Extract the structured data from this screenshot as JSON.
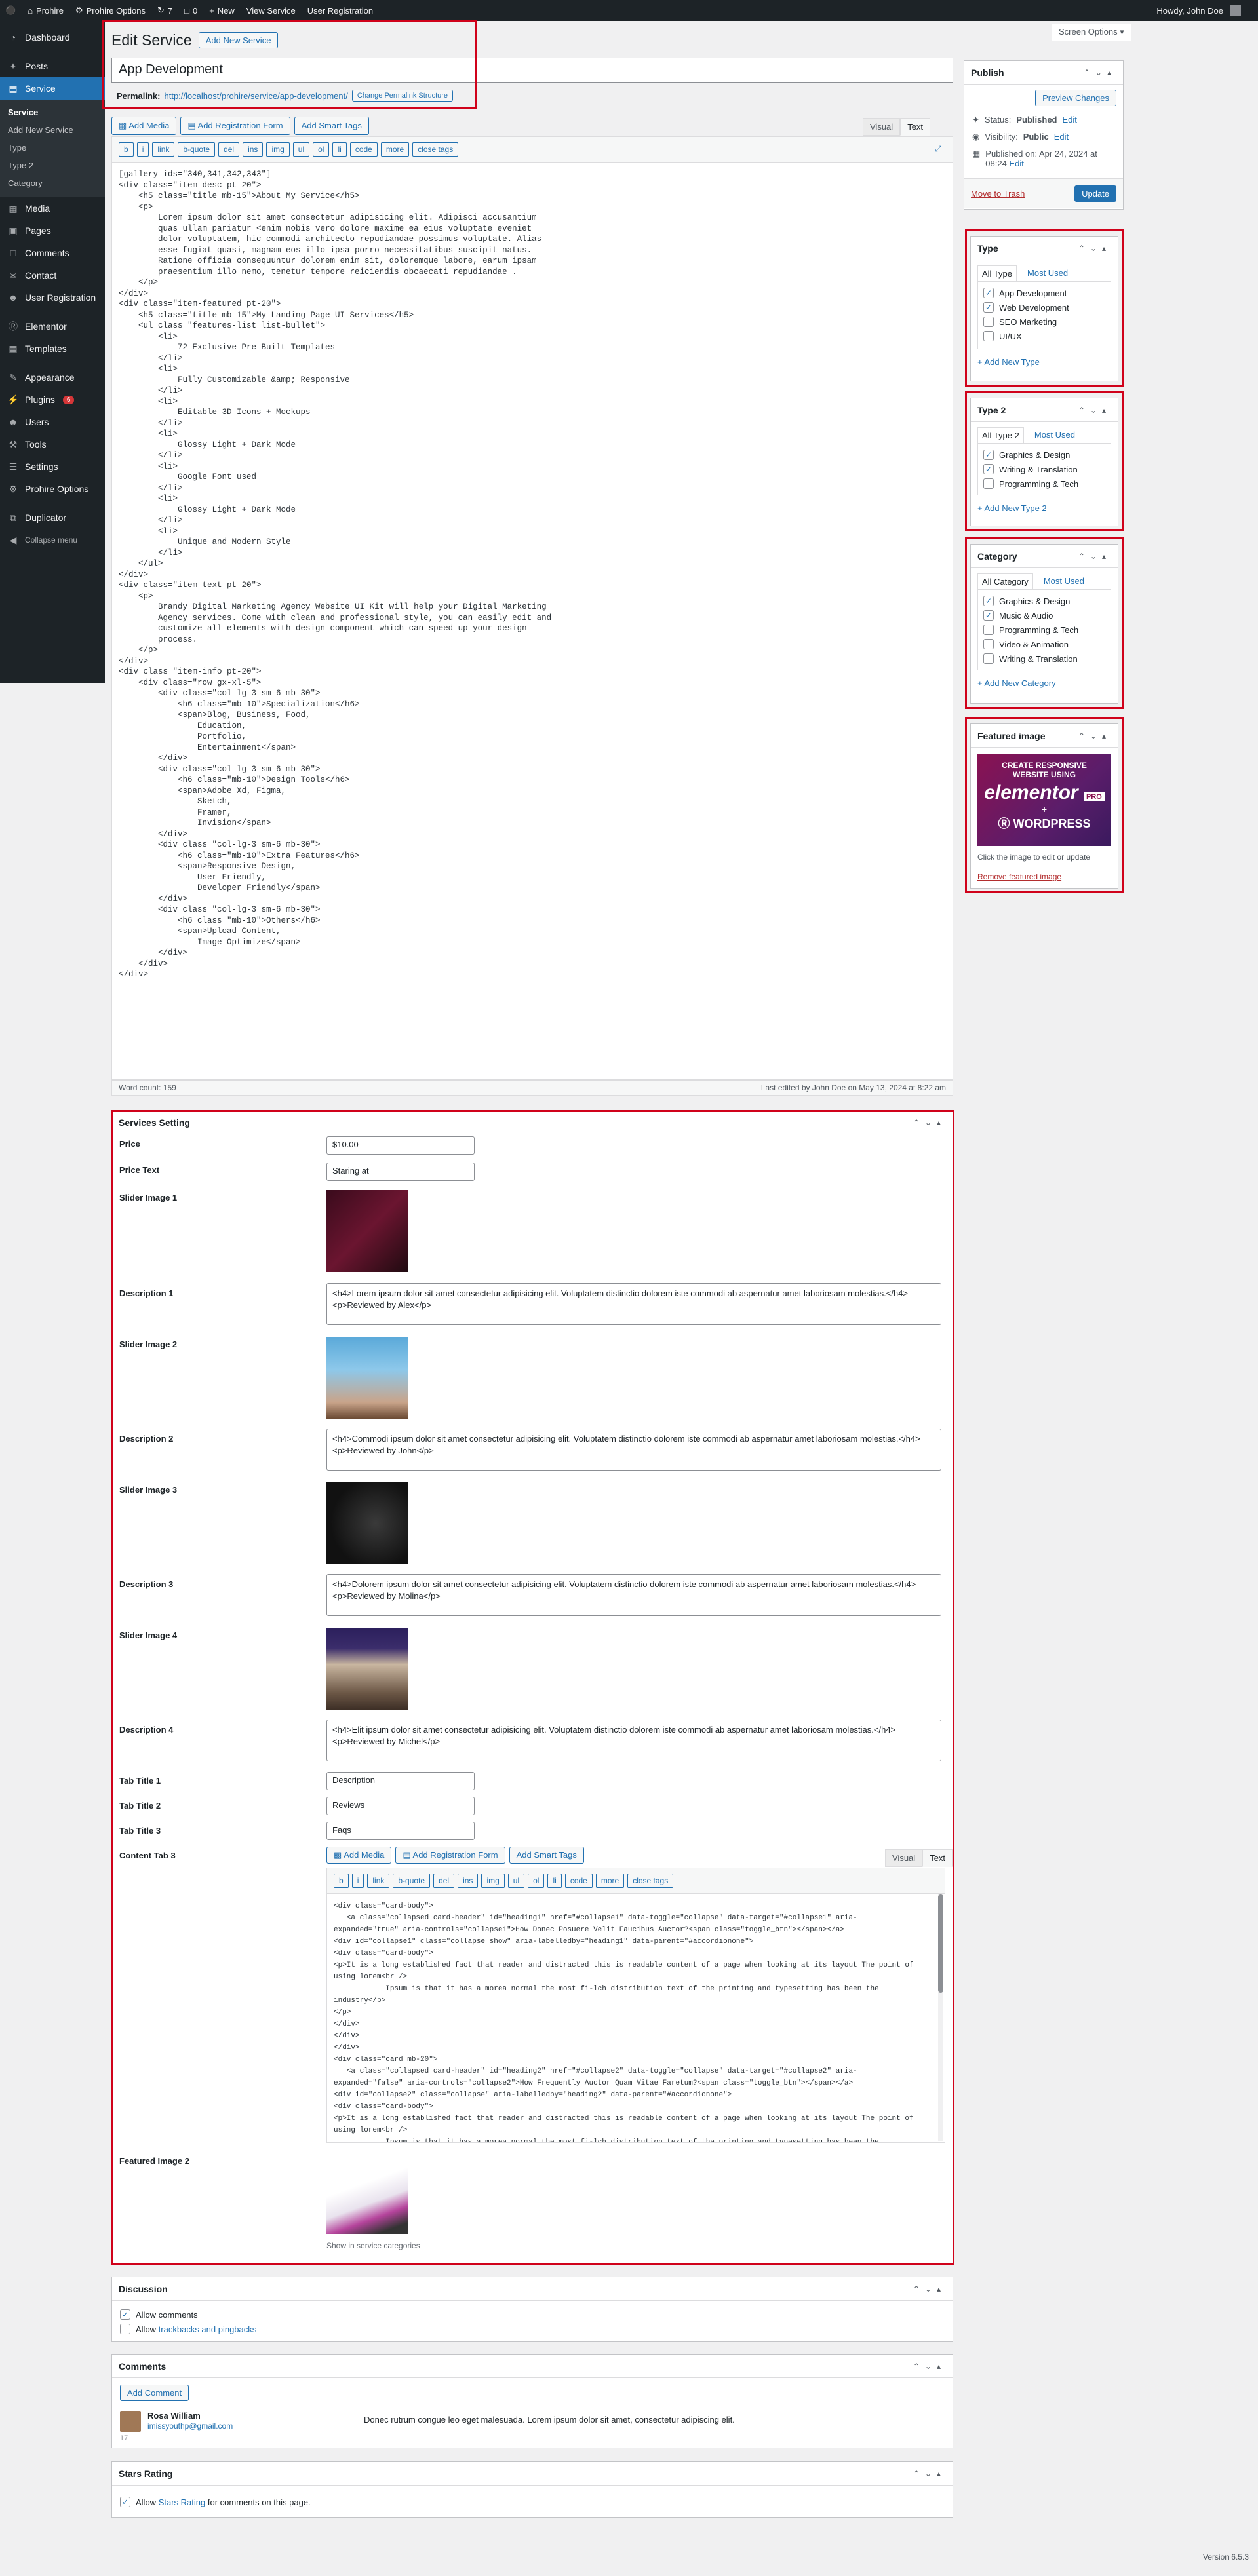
{
  "adminbar": {
    "site": "Prohire",
    "options": "Prohire Options",
    "updates": "7",
    "comments": "0",
    "new": "New",
    "view": "View Service",
    "userreg": "User Registration",
    "howdy": "Howdy, John Doe"
  },
  "menu": {
    "items": [
      {
        "label": "Dashboard",
        "icon": "dashboard-icon"
      },
      {
        "label": "Posts",
        "icon": "pin-icon"
      },
      {
        "label": "Service",
        "icon": "briefcase-icon"
      }
    ],
    "service_sub": [
      "Service",
      "Add New Service",
      "Type",
      "Type 2",
      "Category"
    ],
    "rest": [
      {
        "label": "Media",
        "icon": "media-icon"
      },
      {
        "label": "Pages",
        "icon": "page-icon"
      },
      {
        "label": "Comments",
        "icon": "comment-icon"
      },
      {
        "label": "Contact",
        "icon": "mail-icon"
      },
      {
        "label": "User Registration",
        "icon": "user-registration-icon"
      }
    ],
    "rest2": [
      {
        "label": "Elementor",
        "icon": "elementor-icon"
      },
      {
        "label": "Templates",
        "icon": "templates-icon"
      }
    ],
    "rest3": [
      {
        "label": "Appearance",
        "icon": "brush-icon"
      },
      {
        "label": "Plugins",
        "icon": "plugin-icon",
        "badge": "6"
      },
      {
        "label": "Users",
        "icon": "users-icon"
      },
      {
        "label": "Tools",
        "icon": "wrench-icon"
      },
      {
        "label": "Settings",
        "icon": "settings-icon"
      },
      {
        "label": "Prohire Options",
        "icon": "gear-icon"
      }
    ],
    "rest4": [
      {
        "label": "Duplicator",
        "icon": "duplicator-icon"
      }
    ],
    "collapse": "Collapse menu"
  },
  "screen_options": "Screen Options ▾",
  "page": {
    "title": "Edit Service",
    "add_new": "Add New Service",
    "post_title": "App Development",
    "permalink_label": "Permalink:",
    "permalink_url": "http://localhost/prohire/service/app-development/",
    "change_permalink": "Change Permalink Structure"
  },
  "editor": {
    "add_media": "Add Media",
    "add_reg_form": "Add Registration Form",
    "add_smart_tags": "Add Smart Tags",
    "visual": "Visual",
    "text": "Text",
    "qtags": [
      "b",
      "i",
      "link",
      "b-quote",
      "del",
      "ins",
      "img",
      "ul",
      "ol",
      "li",
      "code",
      "more",
      "close tags"
    ],
    "code": "[gallery ids=\"340,341,342,343\"]\n<div class=\"item-desc pt-20\">\n    <h5 class=\"title mb-15\">About My Service</h5>\n    <p>\n        Lorem ipsum dolor sit amet consectetur adipisicing elit. Adipisci accusantium\n        quas ullam pariatur <enim nobis vero dolore maxime ea eius voluptate eveniet\n        dolor voluptatem, hic commodi architecto repudiandae possimus voluptate. Alias\n        esse fugiat quasi, magnam eos illo ipsa porro necessitatibus suscipit natus.\n        Ratione officia consequuntur dolorem enim sit, doloremque labore, earum ipsam\n        praesentium illo nemo, tenetur tempore reiciendis obcaecati repudiandae .\n    </p>\n</div>\n<div class=\"item-featured pt-20\">\n    <h5 class=\"title mb-15\">My Landing Page UI Services</h5>\n    <ul class=\"features-list list-bullet\">\n        <li>\n            72 Exclusive Pre-Built Templates\n        </li>\n        <li>\n            Fully Customizable &amp; Responsive\n        </li>\n        <li>\n            Editable 3D Icons + Mockups\n        </li>\n        <li>\n            Glossy Light + Dark Mode\n        </li>\n        <li>\n            Google Font used\n        </li>\n        <li>\n            Glossy Light + Dark Mode\n        </li>\n        <li>\n            Unique and Modern Style\n        </li>\n    </ul>\n</div>\n<div class=\"item-text pt-20\">\n    <p>\n        Brandy Digital Marketing Agency Website UI Kit will help your Digital Marketing\n        Agency services. Come with clean and professional style, you can easily edit and\n        customize all elements with design component which can speed up your design\n        process.\n    </p>\n</div>\n<div class=\"item-info pt-20\">\n    <div class=\"row gx-xl-5\">\n        <div class=\"col-lg-3 sm-6 mb-30\">\n            <h6 class=\"mb-10\">Specialization</h6>\n            <span>Blog, Business, Food,\n                Education,\n                Portfolio,\n                Entertainment</span>\n        </div>\n        <div class=\"col-lg-3 sm-6 mb-30\">\n            <h6 class=\"mb-10\">Design Tools</h6>\n            <span>Adobe Xd, Figma,\n                Sketch,\n                Framer,\n                Invision</span>\n        </div>\n        <div class=\"col-lg-3 sm-6 mb-30\">\n            <h6 class=\"mb-10\">Extra Features</h6>\n            <span>Responsive Design,\n                User Friendly,\n                Developer Friendly</span>\n        </div>\n        <div class=\"col-lg-3 sm-6 mb-30\">\n            <h6 class=\"mb-10\">Others</h6>\n            <span>Upload Content,\n                Image Optimize</span>\n        </div>\n    </div>\n</div>",
    "word_count": "Word count: 159",
    "last_edited": "Last edited by John Doe on May 13, 2024 at 8:22 am"
  },
  "publish": {
    "title": "Publish",
    "preview": "Preview Changes",
    "status_label": "Status:",
    "status": "Published",
    "edit": "Edit",
    "visibility_label": "Visibility:",
    "visibility": "Public",
    "published_on": "Published on: Apr 24, 2024 at 08:24",
    "trash": "Move to Trash",
    "update": "Update"
  },
  "type": {
    "title": "Type",
    "tab_all": "All Type",
    "tab_most": "Most Used",
    "items": [
      {
        "label": "App Development",
        "checked": true
      },
      {
        "label": "Web Development",
        "checked": true
      },
      {
        "label": "SEO Marketing",
        "checked": false
      },
      {
        "label": "UI/UX",
        "checked": false
      }
    ],
    "add": "+ Add New Type"
  },
  "type2": {
    "title": "Type 2",
    "tab_all": "All Type 2",
    "tab_most": "Most Used",
    "items": [
      {
        "label": "Graphics & Design",
        "checked": true
      },
      {
        "label": "Writing & Translation",
        "checked": true
      },
      {
        "label": "Programming & Tech",
        "checked": false
      }
    ],
    "add": "+ Add New Type 2"
  },
  "category": {
    "title": "Category",
    "tab_all": "All Category",
    "tab_most": "Most Used",
    "items": [
      {
        "label": "Graphics & Design",
        "checked": true
      },
      {
        "label": "Music & Audio",
        "checked": true
      },
      {
        "label": "Programming & Tech",
        "checked": false
      },
      {
        "label": "Video & Animation",
        "checked": false
      },
      {
        "label": "Writing & Translation",
        "checked": false
      }
    ],
    "add": "+ Add New Category"
  },
  "featured": {
    "title": "Featured image",
    "img_line1": "CREATE RESPONSIVE",
    "img_line2": "WEBSITE USING",
    "img_brand": "elementor",
    "img_pro": "PRO",
    "img_plus": "+",
    "img_wp": "WORDPRESS",
    "hint": "Click the image to edit or update",
    "remove": "Remove featured image"
  },
  "services": {
    "title": "Services Setting",
    "price_label": "Price",
    "price": "$10.00",
    "price_text_label": "Price Text",
    "price_text": "Staring at",
    "slider1": "Slider Image 1",
    "desc1_label": "Description 1",
    "desc1": "<h4>Lorem ipsum dolor sit amet consectetur adipisicing elit. Voluptatem distinctio dolorem iste commodi ab aspernatur amet laboriosam molestias.</h4>\n<p>Reviewed by Alex</p>",
    "slider2": "Slider Image 2",
    "desc2_label": "Description 2",
    "desc2": "<h4>Commodi ipsum dolor sit amet consectetur adipisicing elit. Voluptatem distinctio dolorem iste commodi ab aspernatur amet laboriosam molestias.</h4>\n<p>Reviewed by John</p>",
    "slider3": "Slider Image 3",
    "desc3_label": "Description 3",
    "desc3": "<h4>Dolorem ipsum dolor sit amet consectetur adipisicing elit. Voluptatem distinctio dolorem iste commodi ab aspernatur amet laboriosam molestias.</h4>\n<p>Reviewed by Molina</p>",
    "slider4": "Slider Image 4",
    "desc4_label": "Description 4",
    "desc4": "<h4>Elit ipsum dolor sit amet consectetur adipisicing elit. Voluptatem distinctio dolorem iste commodi ab aspernatur amet laboriosam molestias.</h4>\n<p>Reviewed by Michel</p>",
    "tab1_label": "Tab Title 1",
    "tab1": "Description",
    "tab2_label": "Tab Title 2",
    "tab2": "Reviews",
    "tab3_label": "Tab Title 3",
    "tab3": "Faqs",
    "content_tab_label": "Content Tab 3",
    "content_tab_code": "<div class=\"card-body\">\n   <a class=\"collapsed card-header\" id=\"heading1\" href=\"#collapse1\" data-toggle=\"collapse\" data-target=\"#collapse1\" aria-\nexpanded=\"true\" aria-controls=\"collapse1\">How Donec Posuere Velit Faucibus Auctor?<span class=\"toggle_btn\"></span></a>\n<div id=\"collapse1\" class=\"collapse show\" aria-labelledby=\"heading1\" data-parent=\"#accordionone\">\n<div class=\"card-body\">\n<p>It is a long established fact that reader and distracted this is readable content of a page when looking at its layout The point of\nusing lorem<br />\n            Ipsum is that it has a morea normal the most fi-lch distribution text of the printing and typesetting has been the\nindustry</p>\n</p>\n</div>\n</div>\n</div>\n<div class=\"card mb-20\">\n   <a class=\"collapsed card-header\" id=\"heading2\" href=\"#collapse2\" data-toggle=\"collapse\" data-target=\"#collapse2\" aria-\nexpanded=\"false\" aria-controls=\"collapse2\">How Frequently Auctor Quam Vitae Faretum?<span class=\"toggle_btn\"></span></a>\n<div id=\"collapse2\" class=\"collapse\" aria-labelledby=\"heading2\" data-parent=\"#accordionone\">\n<div class=\"card-body\">\n<p>It is a long established fact that reader and distracted this is readable content of a page when looking at its layout The point of\nusing lorem<br />\n            Ipsum is that it has a morea normal the most fi-lch distribution text of the printing and typesetting has been the",
    "featured2_label": "Featured Image 2",
    "show_in": "Show in service categories"
  },
  "discussion": {
    "title": "Discussion",
    "allow_comments": "Allow comments",
    "allow_tb_prefix": "Allow ",
    "allow_tb_link": "trackbacks and pingbacks"
  },
  "comments": {
    "title": "Comments",
    "add": "Add Comment",
    "author": "Rosa William",
    "email": "imissyouthp@gmail.com",
    "text": "Donec rutrum congue leo eget malesuada. Lorem ipsum dolor sit amet, consectetur adipiscing elit.",
    "count": "17"
  },
  "stars": {
    "title": "Stars Rating",
    "allow_prefix": "Allow ",
    "link": "Stars Rating",
    "allow_suffix": " for comments on this page."
  },
  "version": "Version 6.5.3"
}
